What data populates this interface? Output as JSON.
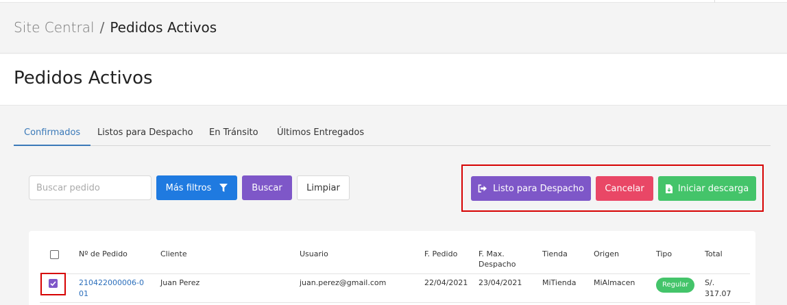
{
  "breadcrumb": {
    "parent": "Site Central",
    "separator": "/",
    "current": "Pedidos Activos"
  },
  "page_title": "Pedidos Activos",
  "tabs": [
    {
      "label": "Confirmados",
      "active": true
    },
    {
      "label": "Listos para Despacho",
      "active": false
    },
    {
      "label": "En Tránsito",
      "active": false
    },
    {
      "label": "Últimos Entregados",
      "active": false
    }
  ],
  "toolbar": {
    "search_placeholder": "Buscar pedido",
    "more_filters_label": "Más filtros",
    "search_label": "Buscar",
    "clear_label": "Limpiar"
  },
  "actions": {
    "ready_label": "Listo para Despacho",
    "cancel_label": "Cancelar",
    "download_label": "Iniciar descarga"
  },
  "table": {
    "headers": {
      "order_no": "Nº de Pedido",
      "client": "Cliente",
      "user": "Usuario",
      "order_date": "F. Pedido",
      "max_dispatch": "F. Max. Despacho",
      "store": "Tienda",
      "origin": "Origen",
      "type": "Tipo",
      "total": "Total"
    },
    "rows": [
      {
        "checked": true,
        "order_no": "210422000006-001",
        "client": "Juan Perez",
        "user": "juan.perez@gmail.com",
        "order_date": "22/04/2021",
        "max_dispatch": "23/04/2021",
        "store": "MiTienda",
        "origin": "MiAlmacen",
        "type": "Regular",
        "total": "S/. 317.07"
      }
    ]
  },
  "colors": {
    "primary_blue": "#1f7ae0",
    "purple": "#7e57c8",
    "red": "#e94766",
    "green": "#44c46a",
    "link": "#2a6ebb",
    "highlight_red": "#d60000"
  }
}
